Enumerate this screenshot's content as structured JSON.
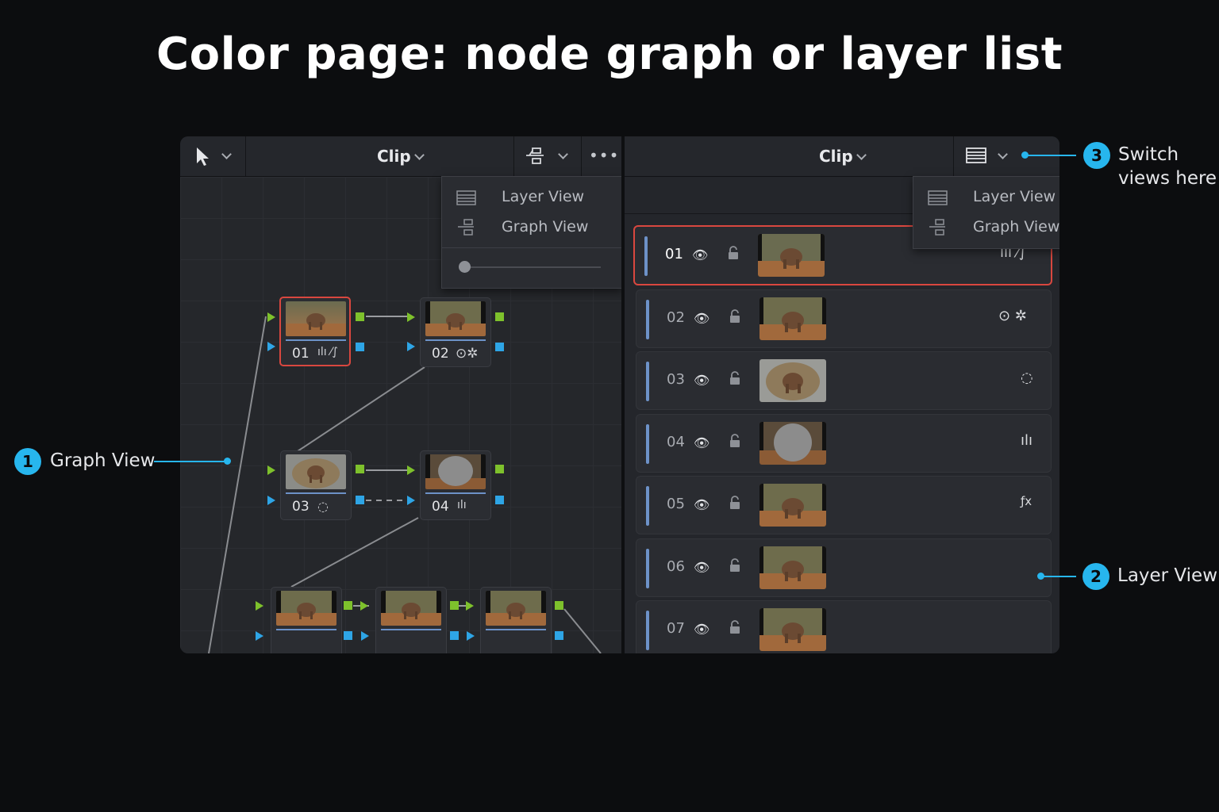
{
  "title": "Color page: node graph or layer list",
  "left_panel": {
    "clip_label": "Clip",
    "more_label": "•••",
    "menu": {
      "items": [
        "Layer View",
        "Graph View"
      ],
      "slider_value": 0.0
    },
    "nodes": [
      {
        "label": "01",
        "icons": "ılı ⁄∫",
        "selected": true
      },
      {
        "label": "02",
        "icons": "⊙✲",
        "selected": false
      },
      {
        "label": "03",
        "icons": "◌",
        "selected": false
      },
      {
        "label": "04",
        "icons": "ılı",
        "selected": false
      },
      {
        "label": "",
        "icons": "",
        "selected": false
      },
      {
        "label": "",
        "icons": "",
        "selected": false
      },
      {
        "label": "",
        "icons": "",
        "selected": false
      }
    ]
  },
  "right_panel": {
    "clip_label": "Clip",
    "menu": {
      "items": [
        "Layer View",
        "Graph View"
      ]
    },
    "layers": [
      {
        "num": "01",
        "icons": "ılı ⁄∫",
        "selected": true
      },
      {
        "num": "02",
        "icons": "⊙ ✲",
        "selected": false
      },
      {
        "num": "03",
        "icons": "◌",
        "selected": false
      },
      {
        "num": "04",
        "icons": "ılı",
        "selected": false
      },
      {
        "num": "05",
        "icons": "ƒx",
        "selected": false
      },
      {
        "num": "06",
        "icons": "",
        "selected": false
      },
      {
        "num": "07",
        "icons": "",
        "selected": false
      }
    ]
  },
  "callouts": {
    "graph_view": {
      "badge": "1",
      "text": "Graph View"
    },
    "layer_view": {
      "badge": "2",
      "text": "Layer View"
    },
    "switch": {
      "badge": "3",
      "line1": "Switch",
      "line2": "views here"
    }
  },
  "colors": {
    "selected_border": "#d9473f",
    "input_green": "#7ec12c",
    "output_blue": "#2ea5e6",
    "callout_accent": "#27b6ee",
    "node_bar": "#6d92c8"
  }
}
